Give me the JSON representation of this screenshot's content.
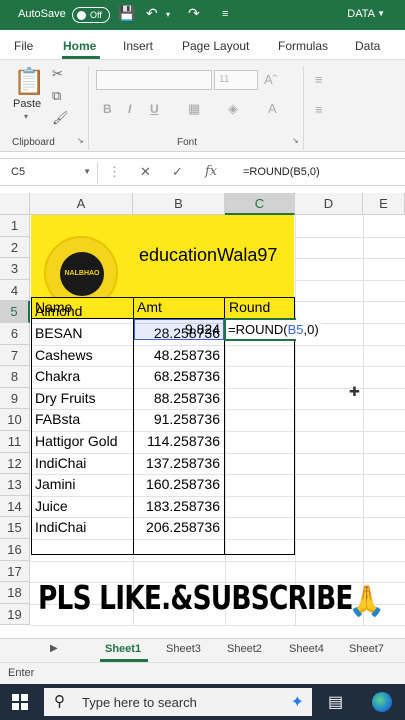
{
  "titlebar": {
    "autosave_label": "AutoSave",
    "toggle_state": "Off",
    "doc_name": "DATA"
  },
  "ribbon_tabs": [
    "File",
    "Home",
    "Insert",
    "Page Layout",
    "Formulas",
    "Data"
  ],
  "ribbon": {
    "paste_label": "Paste",
    "clipboard_label": "Clipboard",
    "font_label": "Font",
    "font_size_value": "11"
  },
  "formula_bar": {
    "name_box": "C5",
    "formula": "=ROUND(B5,0)"
  },
  "grid": {
    "columns": [
      "A",
      "B",
      "C",
      "D",
      "E"
    ],
    "rows": [
      "1",
      "2",
      "3",
      "4",
      "5",
      "6",
      "7",
      "8",
      "9",
      "10",
      "11",
      "12",
      "13",
      "14",
      "15",
      "16",
      "17",
      "18",
      "19"
    ],
    "title_text": "educationWala97",
    "logo_text": "NALBHAO",
    "headers": {
      "name": "Name",
      "amt": "Amt",
      "round": "Round"
    },
    "table_rows": [
      {
        "name": "Almond",
        "amt": "9.824"
      },
      {
        "name": "BESAN",
        "amt": "28.258736"
      },
      {
        "name": "Cashews",
        "amt": "48.258736"
      },
      {
        "name": "Chakra",
        "amt": "68.258736"
      },
      {
        "name": "Dry Fruits",
        "amt": "88.258736"
      },
      {
        "name": "FABsta",
        "amt": "91.258736"
      },
      {
        "name": "Hattigor Gold",
        "amt": "114.258736"
      },
      {
        "name": "IndiChai",
        "amt": "137.258736"
      },
      {
        "name": "Jamini",
        "amt": "160.258736"
      },
      {
        "name": "Juice",
        "amt": "183.258736"
      },
      {
        "name": "IndiChai",
        "amt": "206.258736"
      }
    ],
    "editing": {
      "prefix": "=ROUND(",
      "ref": "B5",
      "suffix": ",0)"
    },
    "banner": "PLS LIKE.&SUBSCRIBE",
    "banner_emoji": "🙏"
  },
  "sheets": [
    "Sheet1",
    "Sheet3",
    "Sheet2",
    "Sheet4",
    "Sheet7"
  ],
  "status": {
    "mode": "Enter"
  },
  "taskbar": {
    "search_placeholder": "Type here to search"
  },
  "colors": {
    "excel_green": "#217346",
    "highlight_yellow": "#ffe81a",
    "ref_blue": "#3b66d8"
  }
}
